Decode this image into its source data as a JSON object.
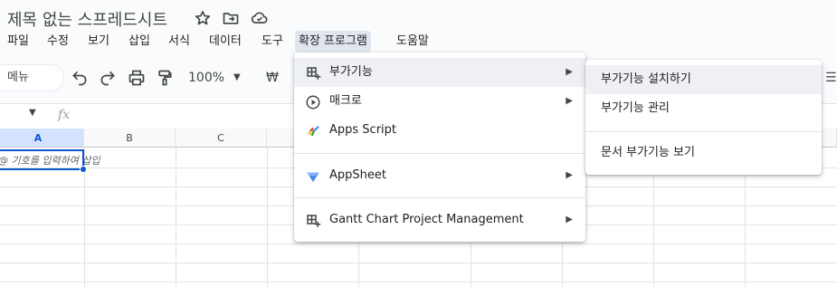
{
  "doc": {
    "title": "제목 없는 스프레드시트"
  },
  "menubar": {
    "items": [
      "파일",
      "수정",
      "보기",
      "삽입",
      "서식",
      "데이터",
      "도구",
      "확장 프로그램",
      "도움말"
    ],
    "active": "확장 프로그램"
  },
  "toolbar": {
    "menu_label": "메뉴",
    "zoom": "100%",
    "currency_symbol": "₩"
  },
  "formula_bar": {
    "fx": "fx"
  },
  "grid": {
    "columns": [
      "A",
      "B",
      "C"
    ],
    "cell_hint": "@ 기호를 입력하여 삽입"
  },
  "extensions_menu": {
    "items": [
      {
        "label": "부가기능",
        "icon": "addon-icon",
        "has_submenu": true
      },
      {
        "label": "매크로",
        "icon": "macro-play-icon",
        "has_submenu": true
      },
      {
        "label": "Apps Script",
        "icon": "apps-script-icon",
        "has_submenu": false
      },
      {
        "label": "AppSheet",
        "icon": "appsheet-icon",
        "has_submenu": true
      },
      {
        "label": "Gantt Chart Project Management",
        "icon": "addon-icon",
        "has_submenu": true
      }
    ]
  },
  "addons_submenu": {
    "items": [
      "부가기능 설치하기",
      "부가기능 관리",
      "문서 부가기능 보기"
    ]
  },
  "colors": {
    "accent": "#0b57d0",
    "hover": "#eef0f3",
    "menu_active": "#e1e6ee",
    "appsheet": "#4285f4"
  }
}
